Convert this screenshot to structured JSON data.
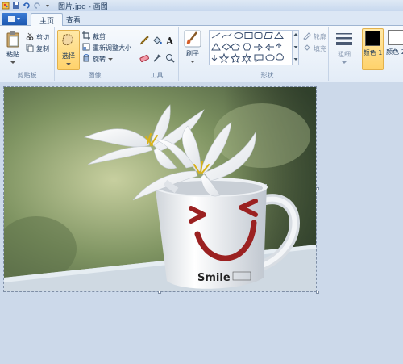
{
  "window": {
    "title": "图片.jpg - 画图"
  },
  "tabs": [
    {
      "label": "主页"
    },
    {
      "label": "查看"
    }
  ],
  "clipboard": {
    "paste": "粘贴",
    "cut": "剪切",
    "copy": "复制",
    "label": "剪贴板"
  },
  "image_group": {
    "select": "选择",
    "crop": "裁剪",
    "resize": "重新调整大小",
    "rotate": "旋转",
    "label": "图像"
  },
  "tools": {
    "label": "工具"
  },
  "brushes": {
    "label": "刷子"
  },
  "shapes": {
    "outline": "轮廓",
    "fill": "填充",
    "label": "形状"
  },
  "size": {
    "label": "粗细"
  },
  "colors": {
    "color1": "颜色 1",
    "color2": "颜色 2",
    "color1_value": "#000000",
    "color2_value": "#ffffff"
  },
  "cup": {
    "text": "Smile"
  },
  "accent": "#1d58b1"
}
